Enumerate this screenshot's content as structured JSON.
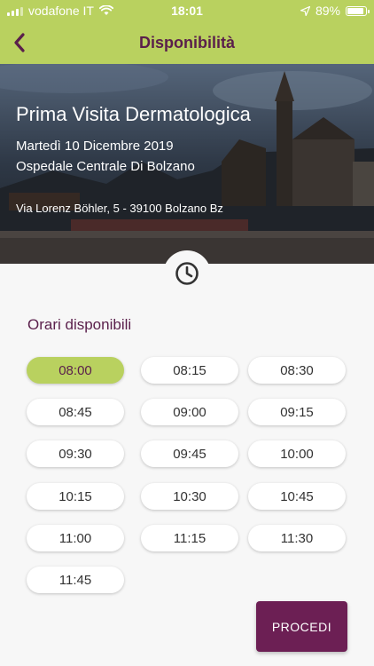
{
  "status_bar": {
    "carrier": "vodafone IT",
    "time": "18:01",
    "battery": "89%",
    "battery_level": 0.89,
    "signal_icon": "signal-bars-icon",
    "wifi_icon": "wifi-icon",
    "location_icon": "location-arrow-icon"
  },
  "nav": {
    "title": "Disponibilità",
    "back_icon": "chevron-left-icon"
  },
  "hero": {
    "title": "Prima Visita Dermatologica",
    "date": "Martedì 10 Dicembre 2019",
    "hospital": "Ospedale Centrale Di Bolzano",
    "address": "Via Lorenz Böhler, 5 - 39100 Bolzano Bz"
  },
  "slots_section": {
    "title": "Orari disponibili",
    "icon": "clock-icon",
    "slots": [
      {
        "time": "08:00",
        "selected": true
      },
      {
        "time": "08:15",
        "selected": false
      },
      {
        "time": "08:30",
        "selected": false
      },
      {
        "time": "08:45",
        "selected": false
      },
      {
        "time": "09:00",
        "selected": false
      },
      {
        "time": "09:15",
        "selected": false
      },
      {
        "time": "09:30",
        "selected": false
      },
      {
        "time": "09:45",
        "selected": false
      },
      {
        "time": "10:00",
        "selected": false
      },
      {
        "time": "10:15",
        "selected": false
      },
      {
        "time": "10:30",
        "selected": false
      },
      {
        "time": "10:45",
        "selected": false
      },
      {
        "time": "11:00",
        "selected": false
      },
      {
        "time": "11:15",
        "selected": false
      },
      {
        "time": "11:30",
        "selected": false
      },
      {
        "time": "11:45",
        "selected": false
      }
    ]
  },
  "actions": {
    "proceed_label": "PROCEDI"
  },
  "colors": {
    "accent_green": "#b9d15f",
    "brand_purple": "#5a1f4b",
    "button_purple": "#6c1f54"
  }
}
